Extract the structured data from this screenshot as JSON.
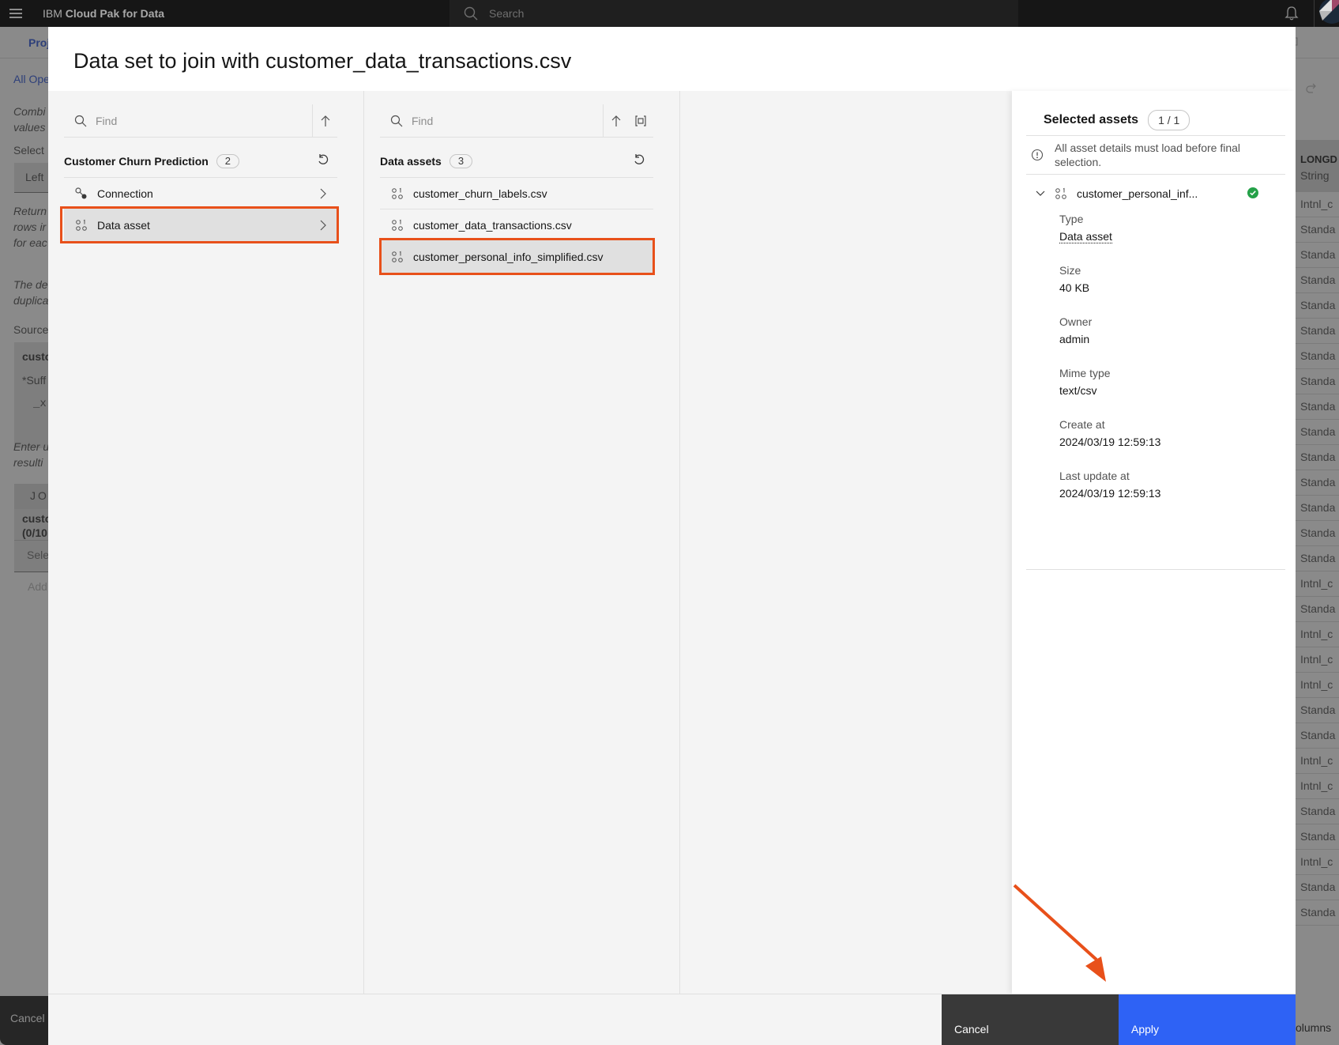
{
  "shell": {
    "brand_prefix": "IBM",
    "brand_name": "Cloud Pak for Data",
    "search_placeholder": "Search",
    "icons": [
      "hamburger-menu-icon",
      "search-icon",
      "notification-bell-icon",
      "user-avatar"
    ]
  },
  "background_page": {
    "tab_fragment": "Proj",
    "link_fragment": "All Ope",
    "text_fragments": [
      "Combi",
      "values",
      "Select",
      "Left",
      "Return",
      "rows ir",
      "for eac",
      "The de",
      "duplica",
      "Source",
      "custo",
      "*Suff",
      "_x",
      "Enter u",
      "resulti",
      "JOI",
      "custo",
      "(0/10",
      "Sele",
      "Add"
    ],
    "cancel_label": "Cancel",
    "table_header": "LONGD",
    "table_header_type": "String",
    "table_cells": [
      "Intnl_c",
      "Standa",
      "Standa",
      "Standa",
      "Standa",
      "Standa",
      "Standa",
      "Standa",
      "Standa",
      "Standa",
      "Standa",
      "Standa",
      "Standa",
      "Standa",
      "Standa",
      "Intnl_c",
      "Standa",
      "Intnl_c",
      "Intnl_c",
      "Intnl_c",
      "Standa",
      "Standa",
      "Intnl_c",
      "Intnl_c",
      "Standa",
      "Standa",
      "Intnl_c",
      "Standa",
      "Standa"
    ],
    "columns_fragment": "olumns"
  },
  "modal": {
    "title": "Data set to join with customer_data_transactions.csv",
    "column1": {
      "find_placeholder": "Find",
      "heading": "Customer Churn Prediction",
      "count": "2",
      "items": [
        {
          "label": "Connection",
          "icon": "connection-icon",
          "selected": false
        },
        {
          "label": "Data asset",
          "icon": "data-asset-icon",
          "selected": true
        }
      ]
    },
    "column2": {
      "find_placeholder": "Find",
      "heading": "Data assets",
      "count": "3",
      "items": [
        {
          "label": "customer_churn_labels.csv",
          "icon": "data-asset-icon",
          "selected": false
        },
        {
          "label": "customer_data_transactions.csv",
          "icon": "data-asset-icon",
          "selected": false
        },
        {
          "label": "customer_personal_info_simplified.csv",
          "icon": "data-asset-icon",
          "selected": true
        }
      ]
    },
    "selected_panel": {
      "heading": "Selected assets",
      "count": "1 / 1",
      "warning": "All asset details must load before final selection.",
      "asset_name": "customer_personal_inf...",
      "status": "loaded-check",
      "details": [
        {
          "key": "Type",
          "value": "Data asset"
        },
        {
          "key": "Size",
          "value": "40 KB"
        },
        {
          "key": "Owner",
          "value": "admin"
        },
        {
          "key": "Mime type",
          "value": "text/csv"
        },
        {
          "key": "Create at",
          "value": "2024/03/19 12:59:13"
        },
        {
          "key": "Last update at",
          "value": "2024/03/19 12:59:13"
        }
      ]
    },
    "footer": {
      "cancel_label": "Cancel",
      "apply_label": "Apply"
    }
  },
  "colors": {
    "highlight": "#e8501a",
    "primary_button": "#2e62f5",
    "secondary_button": "#393939",
    "success": "#24a148",
    "shell": "#161616"
  }
}
